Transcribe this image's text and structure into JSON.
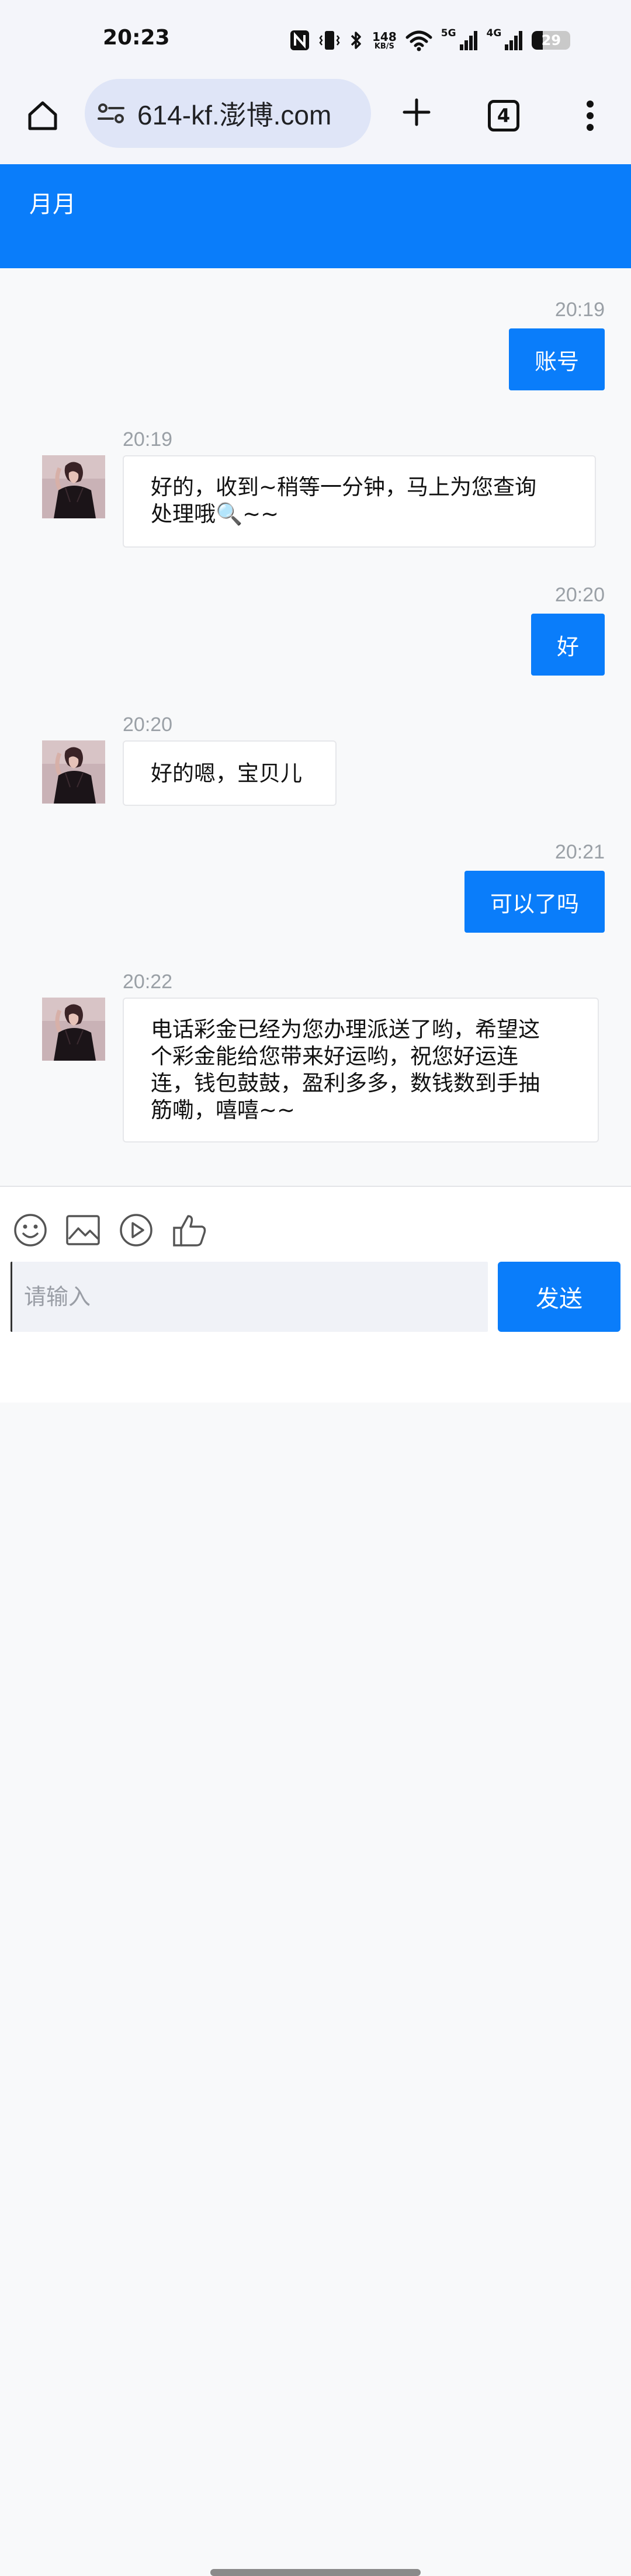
{
  "status_bar": {
    "time": "20:23",
    "net_speed_value": "148",
    "net_speed_unit": "KB/S",
    "sim1_label": "5G",
    "sim2_label": "4G",
    "battery_percent": "29",
    "battery_level": 0.29,
    "icons": [
      "nfc-icon",
      "vibrate-icon",
      "bluetooth-icon",
      "wifi-icon",
      "signal-icon",
      "battery-icon"
    ]
  },
  "browser": {
    "url": "614-kf.澎博.com",
    "tab_count": "4",
    "icons": [
      "home-icon",
      "site-settings-icon",
      "new-tab-icon",
      "tab-switcher-icon",
      "overflow-menu-icon"
    ]
  },
  "chat": {
    "agent_name": "月月",
    "accent_color": "#0a7dfa",
    "messages": [
      {
        "direction": "out",
        "time": "20:19",
        "text": "账号"
      },
      {
        "direction": "in",
        "time": "20:19",
        "lines": [
          "好的，收到~稍等一分钟，马上为您查询",
          "处理哦🔍~~"
        ]
      },
      {
        "direction": "out",
        "time": "20:20",
        "text": "好"
      },
      {
        "direction": "in",
        "time": "20:20",
        "lines": [
          "好的嗯，宝贝儿"
        ]
      },
      {
        "direction": "out",
        "time": "20:21",
        "text": "可以了吗"
      },
      {
        "direction": "in",
        "time": "20:22",
        "lines": [
          "电话彩金已经为您办理派送了哟，希望这",
          "个彩金能给您带来好运哟，祝您好运连",
          "连，钱包鼓鼓，盈利多多，数钱数到手抽",
          "筋嘞，嘻嘻~~"
        ]
      }
    ]
  },
  "composer": {
    "placeholder": "请输入",
    "send_label": "发送",
    "tools": [
      "emoji-icon",
      "image-icon",
      "video-icon",
      "thumbs-up-icon"
    ]
  }
}
